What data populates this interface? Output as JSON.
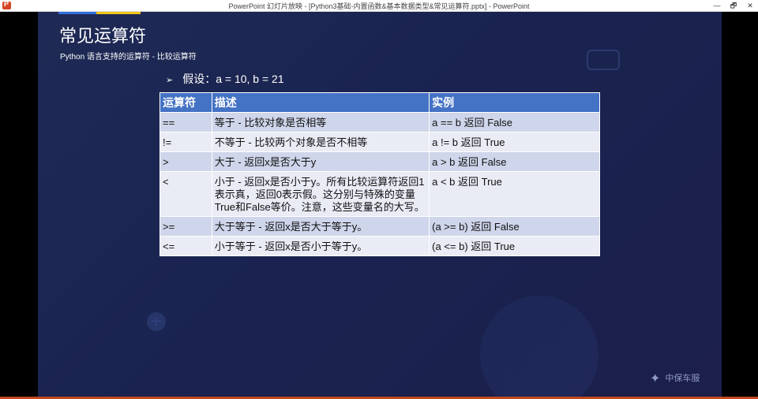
{
  "window": {
    "title": "PowerPoint 幻灯片放映 - [Python3基础-内置函数&基本数据类型&常见运算符.pptx] - PowerPoint",
    "controls": {
      "minimize": "—",
      "restore": "🗗",
      "close": "✕"
    }
  },
  "slide": {
    "title": "常见运算符",
    "subtitle": "Python 语言支持的运算符 - 比较运算符",
    "bullet_marker": "➢",
    "bullet": "假设：a = 10, b = 21",
    "table": {
      "headers": [
        "运算符",
        "描述",
        "实例"
      ],
      "rows": [
        [
          "==",
          "等于 - 比较对象是否相等",
          "a == b 返回 False"
        ],
        [
          "!=",
          "不等于 - 比较两个对象是否不相等",
          "a != b 返回 True"
        ],
        [
          ">",
          "大于 - 返回x是否大于y",
          "a > b 返回 False"
        ],
        [
          "<",
          "小于 - 返回x是否小于y。所有比较运算符返回1表示真，返回0表示假。这分别与特殊的变量True和False等价。注意，这些变量名的大写。",
          "a < b 返回 True"
        ],
        [
          ">=",
          "大于等于 - 返回x是否大于等于y。",
          "(a >= b) 返回 False"
        ],
        [
          "<=",
          "小于等于 - 返回x是否小于等于y。",
          "(a <= b) 返回 True"
        ]
      ]
    },
    "logo_text": "中保车服"
  },
  "colors": {
    "header_bg": "#4472c4",
    "row_odd": "#cfd5ea",
    "row_even": "#e9ebf5",
    "slide_bg": "#1e2a55",
    "accent_blue": "#2f6fe0",
    "accent_yellow": "#f0c419",
    "status_bar": "#c14a1e"
  },
  "icons": [
    "powerpoint-app-icon",
    "minimize-icon",
    "restore-icon",
    "close-icon",
    "logo-icon"
  ]
}
